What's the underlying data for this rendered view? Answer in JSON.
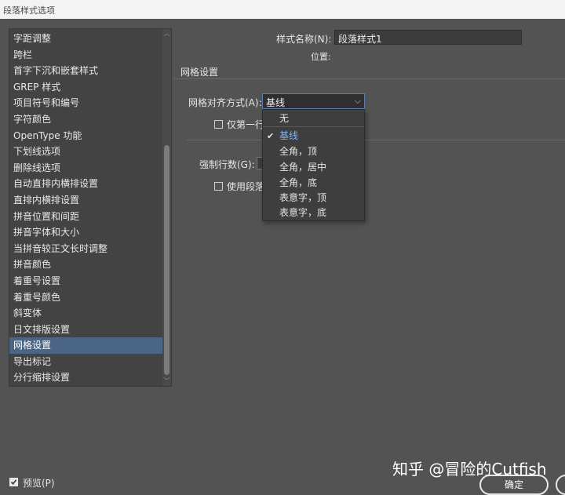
{
  "window": {
    "title": "段落样式选项"
  },
  "sidebar": {
    "selected_index": 19,
    "items": [
      "字距调整",
      "跨栏",
      "首字下沉和嵌套样式",
      "GREP 样式",
      "项目符号和编号",
      "字符颜色",
      "OpenType 功能",
      "下划线选项",
      "删除线选项",
      "自动直排内横排设置",
      "直排内横排设置",
      "拼音位置和间距",
      "拼音字体和大小",
      "当拼音较正文长时调整",
      "拼音颜色",
      "着重号设置",
      "着重号颜色",
      "斜变体",
      "日文排版设置",
      "网格设置",
      "导出标记",
      "分行缩排设置"
    ]
  },
  "form": {
    "style_name_label": "样式名称(N):",
    "style_name_value": "段落样式1",
    "location_label": "位置:",
    "section_title": "网格设置",
    "grid_align_label": "网格对齐方式(A):",
    "grid_align_value": "基线",
    "first_line_only_label": "仅第一行",
    "force_lines_label": "强制行数(G):",
    "use_paragraph_label": "使用段落"
  },
  "dropdown": {
    "selected_index": 1,
    "options": [
      "无",
      "基线",
      "全角，顶",
      "全角，居中",
      "全角，底",
      "表意字，顶",
      "表意字，底"
    ]
  },
  "footer": {
    "preview_label": "预览(P)",
    "preview_checked": true,
    "ok_label": "确定",
    "watermark": "知乎 @冒险的Cutfish"
  },
  "colors": {
    "background": "#535353",
    "panel": "#434343",
    "selection": "#4b6584",
    "dropdown_selected_text": "#7cb4ff"
  }
}
